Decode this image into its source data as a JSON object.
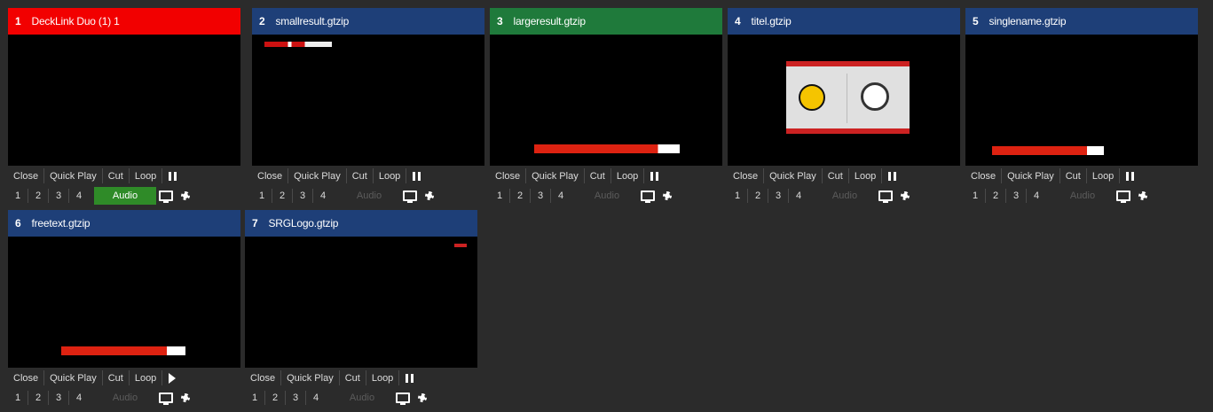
{
  "tiles": [
    {
      "index": "1",
      "name": "DeckLink Duo (1) 1",
      "header_color": "#f20000",
      "audio_on": true,
      "transport": "pause",
      "preview": "none"
    },
    {
      "index": "2",
      "name": "smallresult.gtzip",
      "header_color": "#1e3f78",
      "audio_on": false,
      "transport": "pause",
      "preview": "small-bar"
    },
    {
      "index": "3",
      "name": "largeresult.gtzip",
      "header_color": "#1f7a3b",
      "audio_on": false,
      "transport": "pause",
      "preview": "large-bar"
    },
    {
      "index": "4",
      "name": "titel.gtzip",
      "header_color": "#1e3f78",
      "audio_on": false,
      "transport": "pause",
      "preview": "titel"
    },
    {
      "index": "5",
      "name": "singlename.gtzip",
      "header_color": "#1e3f78",
      "audio_on": false,
      "transport": "pause",
      "preview": "single"
    },
    {
      "index": "6",
      "name": "freetext.gtzip",
      "header_color": "#1e3f78",
      "audio_on": false,
      "transport": "play",
      "preview": "freetext"
    },
    {
      "index": "7",
      "name": "SRGLogo.gtzip",
      "header_color": "#1e3f78",
      "audio_on": false,
      "transport": "pause",
      "preview": "srg"
    }
  ],
  "labels": {
    "close": "Close",
    "quick_play": "Quick Play",
    "cut": "Cut",
    "loop": "Loop",
    "audio": "Audio",
    "n1": "1",
    "n2": "2",
    "n3": "3",
    "n4": "4"
  }
}
